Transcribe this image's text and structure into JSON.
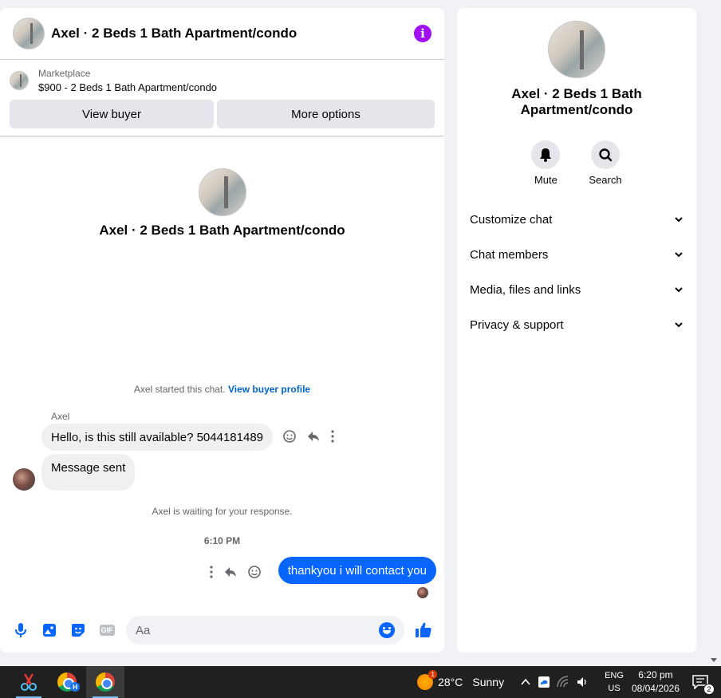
{
  "chat": {
    "header_title": "Axel · 2 Beds 1 Bath Apartment/condo",
    "info_icon_glyph": "i",
    "marketplace": {
      "label": "Marketplace",
      "listing": "$900 - 2 Beds 1 Bath Apartment/condo",
      "view_buyer": "View buyer",
      "more_options": "More options"
    },
    "intro_title": "Axel · 2 Beds 1 Bath Apartment/condo",
    "started_text": "Axel started this chat.",
    "view_buyer_profile": "View buyer profile",
    "sender_name": "Axel",
    "messages": [
      {
        "text": "Hello, is this still available? 5044181489"
      },
      {
        "text": "Message sent"
      }
    ],
    "waiting_text": "Axel is waiting for your response.",
    "timestamp": "6:10 PM",
    "outgoing": "thankyou i will contact you",
    "composer": {
      "placeholder": "Aa",
      "gif_label": "GIF"
    }
  },
  "info_panel": {
    "title": "Axel · 2 Beds 1 Bath Apartment/condo",
    "actions": [
      {
        "label": "Mute",
        "icon": "bell-icon"
      },
      {
        "label": "Search",
        "icon": "search-icon"
      }
    ],
    "menu": [
      {
        "label": "Customize chat"
      },
      {
        "label": "Chat members"
      },
      {
        "label": "Media, files and links"
      },
      {
        "label": "Privacy & support"
      }
    ]
  },
  "taskbar": {
    "chrome_badge": "H",
    "weather_badge": "1",
    "temperature": "28°C",
    "condition": "Sunny",
    "lang_top": "ENG",
    "lang_bottom": "US",
    "time": "6:20 pm",
    "date": "08/04/2026",
    "notification_count": "2"
  },
  "colors": {
    "accent_blue": "#0866ff",
    "info_purple": "#a30ff5",
    "link_blue": "#0064d1"
  }
}
